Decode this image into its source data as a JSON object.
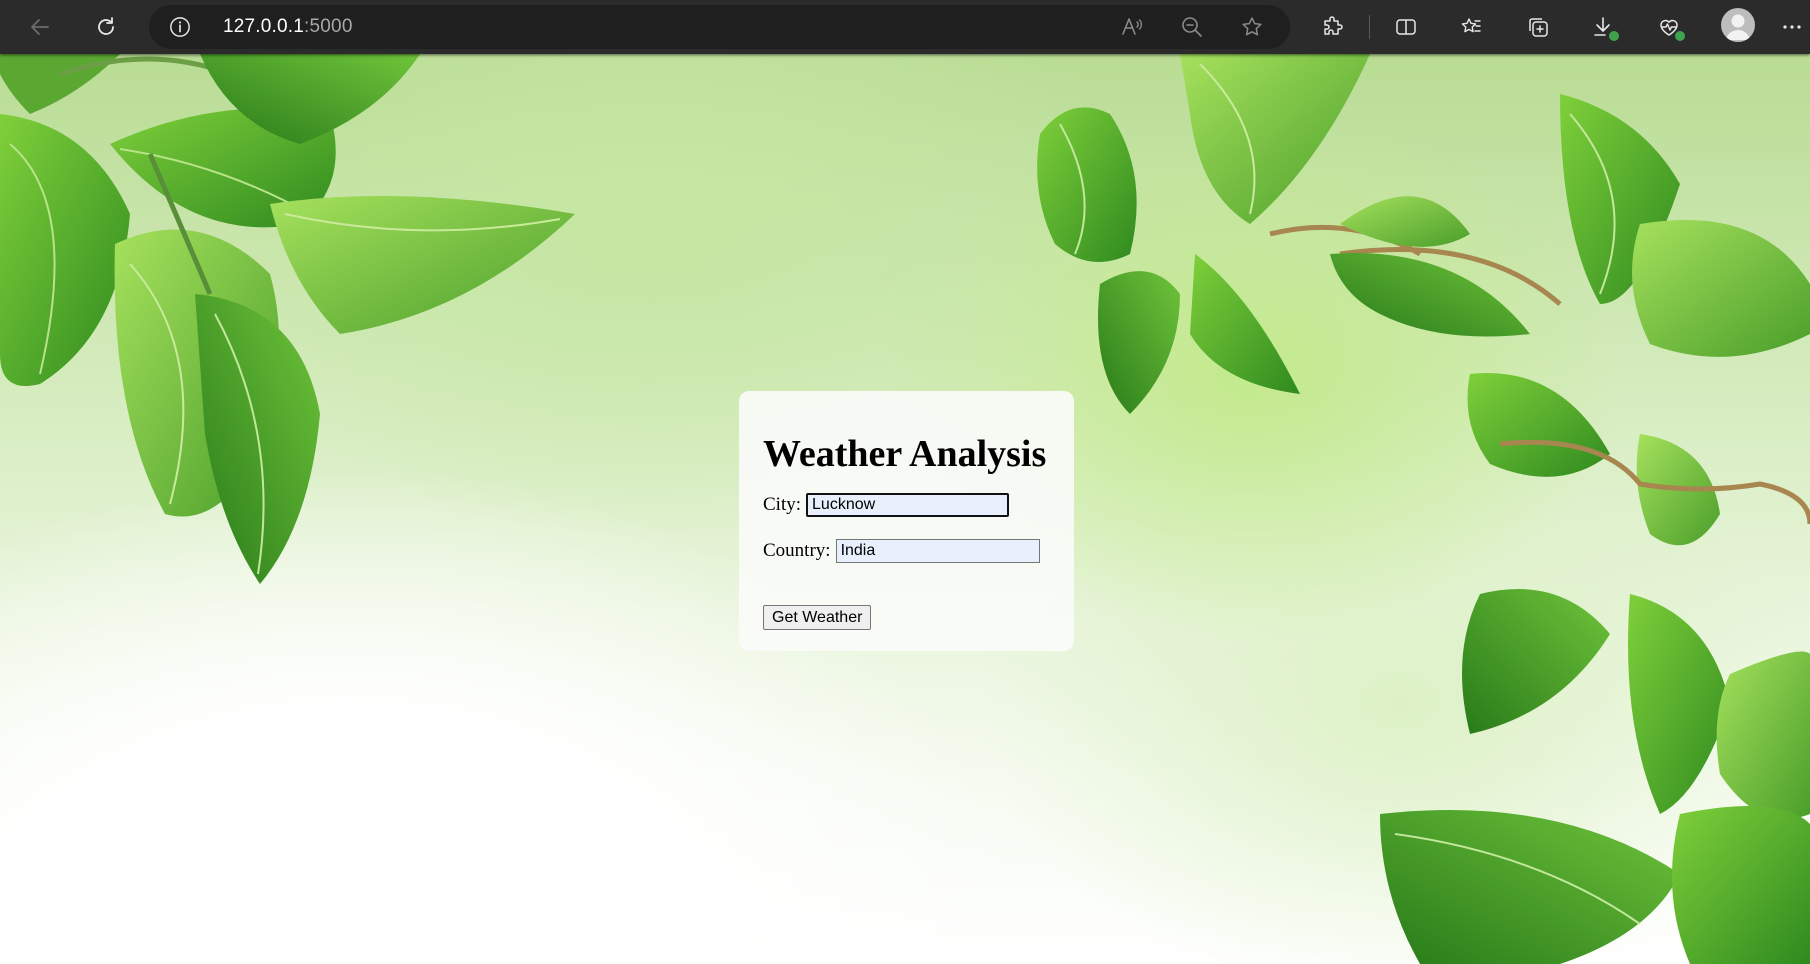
{
  "browser": {
    "url_host": "127.0.0.1",
    "url_port": ":5000"
  },
  "form": {
    "title": "Weather Analysis",
    "city_label": "City:",
    "city_value": "Lucknow",
    "country_label": "Country:",
    "country_value": "India",
    "submit_label": "Get Weather"
  },
  "icons": [
    "back-icon",
    "refresh-icon",
    "info-icon",
    "read-aloud-icon",
    "zoom-out-icon",
    "star-icon",
    "extensions-icon",
    "split-screen-icon",
    "favorites-icon",
    "collections-icon",
    "downloads-icon",
    "browser-essentials-icon",
    "profile-icon",
    "more-icon"
  ]
}
